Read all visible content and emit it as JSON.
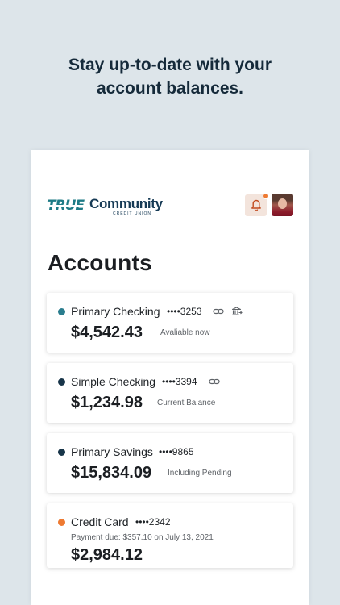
{
  "headline": {
    "line1": "Stay up-to-date with your",
    "line2": "account balances."
  },
  "brand": {
    "true_text": "TRUE",
    "community_text": "Community",
    "credit_union_text": "CREDIT UNION",
    "colors": {
      "teal": "#1e7b86",
      "navy": "#163a55"
    }
  },
  "header": {
    "notification_icon": "bell-icon",
    "notification_badge_color": "#ee7a32",
    "avatar": "user-avatar"
  },
  "page": {
    "title": "Accounts"
  },
  "accounts": [
    {
      "name": "Primary Checking",
      "masked_number": "••••3253",
      "dot_color": "#2a7d8e",
      "icons": [
        "link-icon",
        "bank-transfer-icon"
      ],
      "balance": "$4,542.43",
      "balance_note": "Avaliable now"
    },
    {
      "name": "Simple Checking",
      "masked_number": "••••3394",
      "dot_color": "#183549",
      "icons": [
        "link-icon"
      ],
      "balance": "$1,234.98",
      "balance_note": "Current Balance"
    },
    {
      "name": "Primary Savings",
      "masked_number": "••••9865",
      "dot_color": "#183549",
      "icons": [],
      "balance": "$15,834.09",
      "balance_note": "Including Pending"
    },
    {
      "name": "Credit Card",
      "masked_number": "••••2342",
      "dot_color": "#ee7a32",
      "icons": [],
      "payment_due": "Payment due: $357.10 on July 13, 2021",
      "balance": "$2,984.12"
    }
  ]
}
